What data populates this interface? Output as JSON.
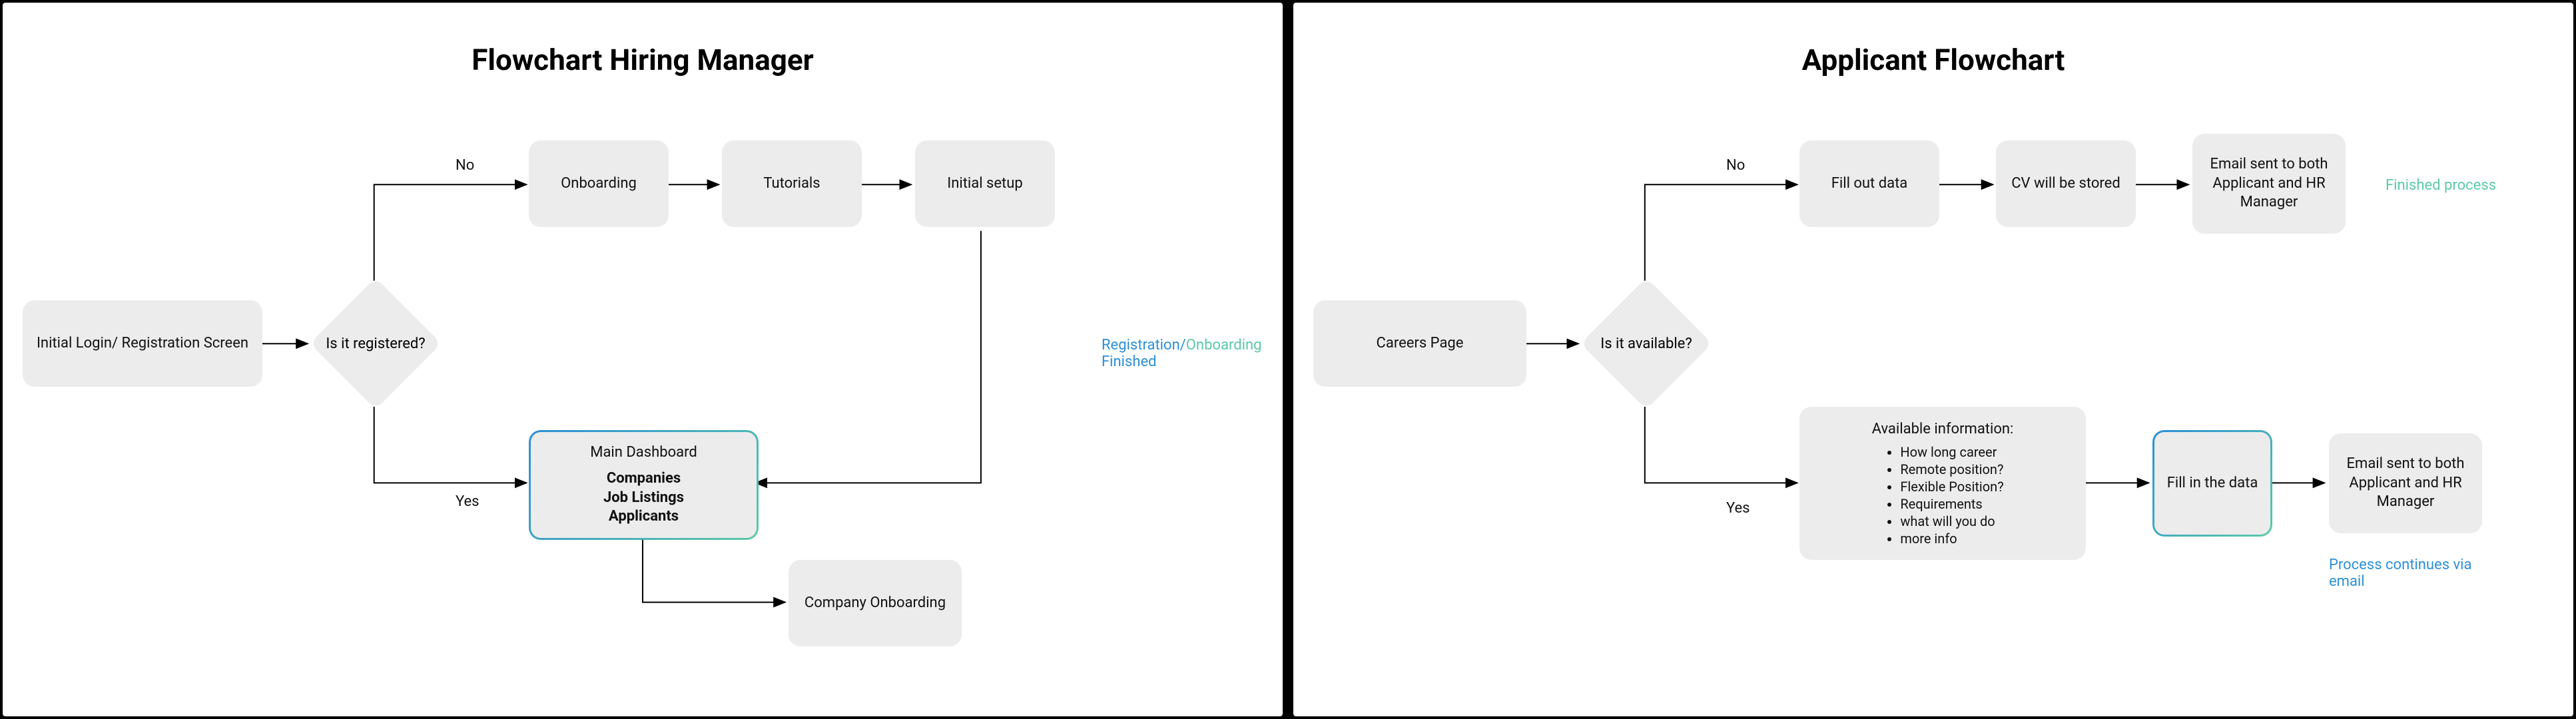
{
  "left": {
    "title": "Flowchart Hiring Manager",
    "nodes": {
      "start": "Initial Login/ Registration Screen",
      "decision": "Is it registered?",
      "no_label": "No",
      "yes_label": "Yes",
      "onboarding": "Onboarding",
      "tutorials": "Tutorials",
      "setup": "Initial setup",
      "dashboard_title": "Main Dashboard",
      "dashboard_items": "Companies\nJob Listings\nApplicants",
      "company_onboarding": "Company Onboarding",
      "annotation_reg": "Registration/",
      "annotation_onb": "Onboarding",
      "annotation_fin": "Finished"
    }
  },
  "right": {
    "title": "Applicant Flowchart",
    "nodes": {
      "start": "Careers Page",
      "decision": "Is it available?",
      "no_label": "No",
      "yes_label": "Yes",
      "fill_out": "Fill out data",
      "cv_stored": "CV will be stored",
      "email_top": "Email sent to both Applicant and HR Manager",
      "finished": "Finished process",
      "info_title": "Available information:",
      "info_items": [
        "How long career",
        "Remote position?",
        "Flexible Position?",
        "Requirements",
        "what will you do",
        "more info"
      ],
      "fill_in": "Fill in the data",
      "email_bottom": "Email sent to both Applicant and HR Manager",
      "process_cont": "Process continues via email"
    }
  }
}
